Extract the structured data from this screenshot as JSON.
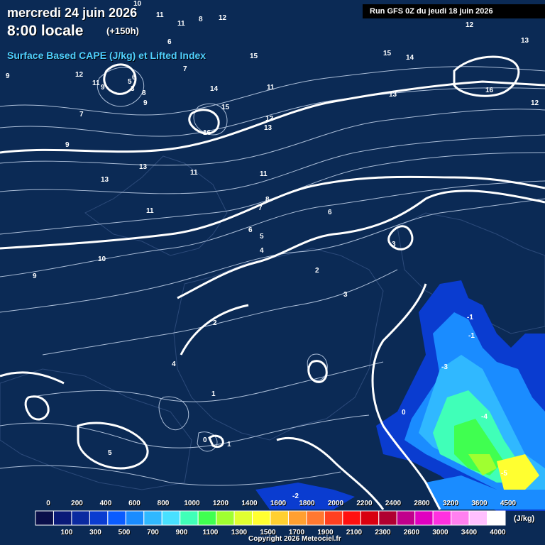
{
  "header": {
    "date": "mercredi 24 juin 2026",
    "time": "8:00 locale",
    "offset": "(+150h)",
    "parameter": "Surface Based CAPE (J/kg) et Lifted Index",
    "run": "Run GFS 0Z du jeudi 18 juin 2026"
  },
  "legend": {
    "unit": "(J/kg)",
    "top_labels": [
      "0",
      "200",
      "400",
      "600",
      "800",
      "1000",
      "1200",
      "1400",
      "1600",
      "1800",
      "2000",
      "2200",
      "2400",
      "2800",
      "3200",
      "3600",
      "4500"
    ],
    "bottom_labels": [
      "100",
      "300",
      "500",
      "700",
      "900",
      "1100",
      "1300",
      "1500",
      "1700",
      "1900",
      "2100",
      "2300",
      "2600",
      "3000",
      "3400",
      "4000"
    ],
    "colors": [
      "#0a0f4a",
      "#0a1a78",
      "#0a2aa0",
      "#0a3cd0",
      "#0a5cff",
      "#1a8cff",
      "#30b8ff",
      "#48e0ff",
      "#40ffb8",
      "#40ff50",
      "#a0ff30",
      "#e0ff30",
      "#ffff30",
      "#ffd030",
      "#ffa030",
      "#ff7830",
      "#ff4020",
      "#ff1010",
      "#d80010",
      "#b00030",
      "#c0008c",
      "#e000c0",
      "#ff30e0",
      "#ff80f0",
      "#ffc0ff",
      "#ffffff"
    ]
  },
  "copyright": "Copyright 2026 Meteociel.fr",
  "li_labels": [
    "10",
    "11",
    "12",
    "8",
    "12",
    "11",
    "13",
    "12",
    "9",
    "11",
    "9",
    "7",
    "5",
    "6",
    "3",
    "8",
    "6",
    "9",
    "11",
    "14",
    "15",
    "7",
    "15",
    "16",
    "13",
    "12",
    "11",
    "13",
    "9",
    "11",
    "8",
    "7",
    "6",
    "5",
    "4",
    "3",
    "10",
    "9",
    "11",
    "13",
    "14",
    "15",
    "16",
    "12",
    "13",
    "6",
    "2",
    "3",
    "4",
    "5",
    "0",
    "1",
    "-1",
    "-2",
    "-3",
    "-4",
    "-5",
    "2",
    "1",
    "0",
    "-1"
  ]
}
